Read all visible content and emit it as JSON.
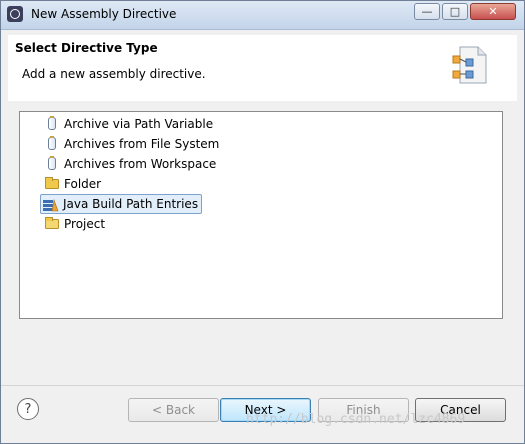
{
  "window": {
    "title": "New Assembly Directive",
    "icon": "eclipse-app-icon"
  },
  "header": {
    "title": "Select Directive Type",
    "description": "Add a new assembly directive."
  },
  "list": {
    "items": [
      {
        "label": "Archive via Path Variable",
        "icon": "jar-icon",
        "selected": false
      },
      {
        "label": "Archives from File System",
        "icon": "jar-icon",
        "selected": false
      },
      {
        "label": "Archives from Workspace",
        "icon": "jar-icon",
        "selected": false
      },
      {
        "label": "Folder",
        "icon": "folder-icon",
        "selected": false
      },
      {
        "label": "Java Build Path Entries",
        "icon": "java-build-path-icon",
        "selected": true
      },
      {
        "label": "Project",
        "icon": "project-folder-icon",
        "selected": false
      }
    ]
  },
  "buttons": {
    "back": "< Back",
    "next": "Next >",
    "finish": "Finish",
    "cancel": "Cancel"
  },
  "help_symbol": "?",
  "watermark": "http://blog.csdn.net/lzc4869",
  "colors": {
    "selection_bg": "#e3eefb",
    "selection_border": "#7da2ce",
    "default_button": "#bee6fd"
  }
}
